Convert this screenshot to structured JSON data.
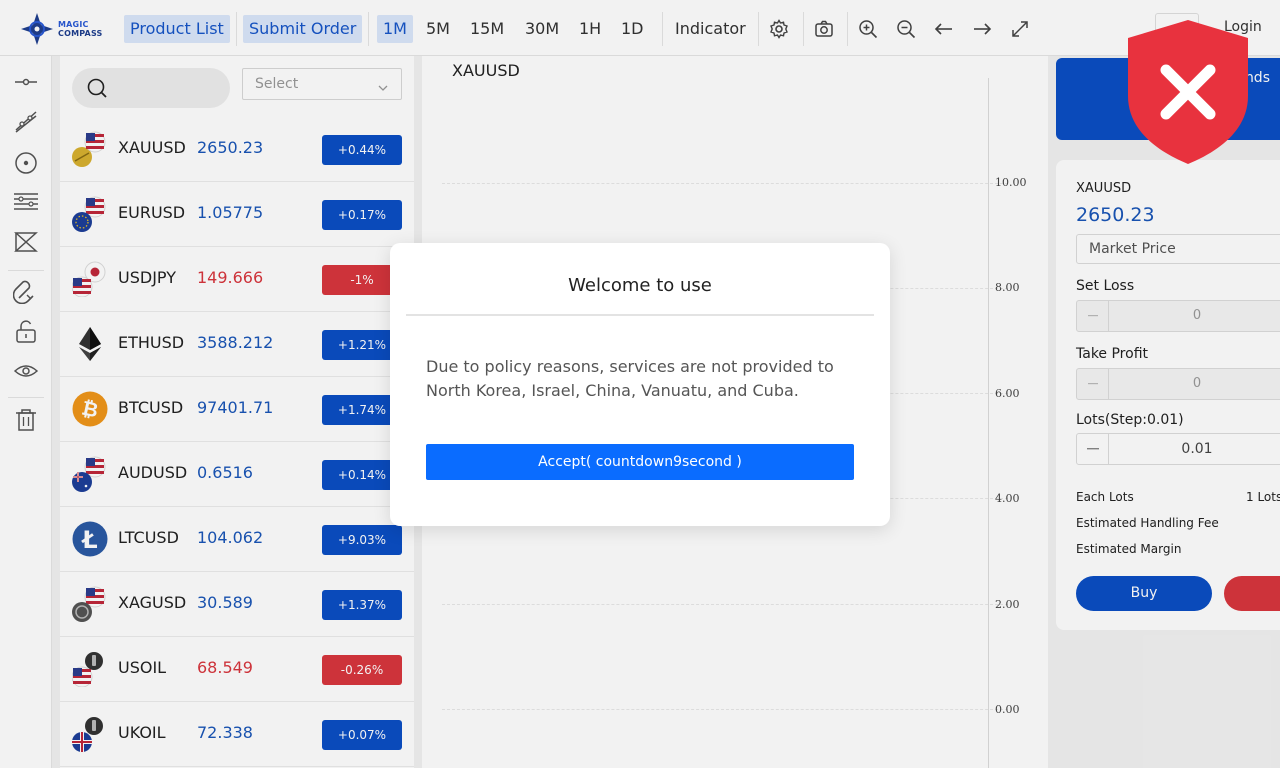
{
  "header": {
    "logo_line1": "MAGIC",
    "logo_line2": "COMPASS",
    "product_list": "Product List",
    "submit_order": "Submit Order",
    "timeframes": [
      "1M",
      "5M",
      "15M",
      "30M",
      "1H",
      "1D"
    ],
    "active_timeframe": "1M",
    "indicator": "Indicator",
    "login": "Login"
  },
  "left_tools": [
    "horizontal-line-icon",
    "trend-line-icon",
    "circle-icon",
    "fib-levels-icon",
    "pattern-icon",
    "magnet-icon",
    "lock-icon",
    "eye-icon",
    "trash-icon"
  ],
  "watchlist": {
    "select_placeholder": "Select",
    "items": [
      {
        "symbol": "XAUUSD",
        "price": "2650.23",
        "change": "+0.44%",
        "direction": "up"
      },
      {
        "symbol": "EURUSD",
        "price": "1.05775",
        "change": "+0.17%",
        "direction": "up"
      },
      {
        "symbol": "USDJPY",
        "price": "149.666",
        "change": "-1%",
        "direction": "down"
      },
      {
        "symbol": "ETHUSD",
        "price": "3588.212",
        "change": "+1.21%",
        "direction": "up"
      },
      {
        "symbol": "BTCUSD",
        "price": "97401.71",
        "change": "+1.74%",
        "direction": "up"
      },
      {
        "symbol": "AUDUSD",
        "price": "0.6516",
        "change": "+0.14%",
        "direction": "up"
      },
      {
        "symbol": "LTCUSD",
        "price": "104.062",
        "change": "+9.03%",
        "direction": "up"
      },
      {
        "symbol": "XAGUSD",
        "price": "30.589",
        "change": "+1.37%",
        "direction": "up"
      },
      {
        "symbol": "USOIL",
        "price": "68.549",
        "change": "-0.26%",
        "direction": "down"
      },
      {
        "symbol": "UKOIL",
        "price": "72.338",
        "change": "+0.07%",
        "direction": "up"
      }
    ]
  },
  "chart": {
    "title": "XAUUSD",
    "y_ticks": [
      "10.00",
      "8.00",
      "6.00",
      "4.00",
      "2.00",
      "0.00"
    ]
  },
  "banner_text": "nds",
  "order": {
    "symbol": "XAUUSD",
    "price": "2650.23",
    "order_type": "Market Price",
    "set_loss_label": "Set Loss",
    "set_loss_value": "0",
    "take_profit_label": "Take Profit",
    "take_profit_value": "0",
    "lots_label": "Lots(Step:0.01)",
    "lots_value": "0.01",
    "each_lots_label": "Each Lots",
    "each_lots_value": "1 Lots",
    "handling_fee_label": "Estimated Handling Fee",
    "margin_label": "Estimated Margin",
    "buy_label": "Buy"
  },
  "modal": {
    "title": "Welcome to use",
    "text": "Due to policy reasons, services are not provided to North Korea, Israel, China, Vanuatu, and Cuba.",
    "accept_label": "Accept( countdown9second )"
  },
  "colors": {
    "accent": "#0b4fc4",
    "accept_button": "#0a6cff",
    "up": "#1a56b8",
    "down": "#d9363e",
    "shield": "#e8323e"
  }
}
